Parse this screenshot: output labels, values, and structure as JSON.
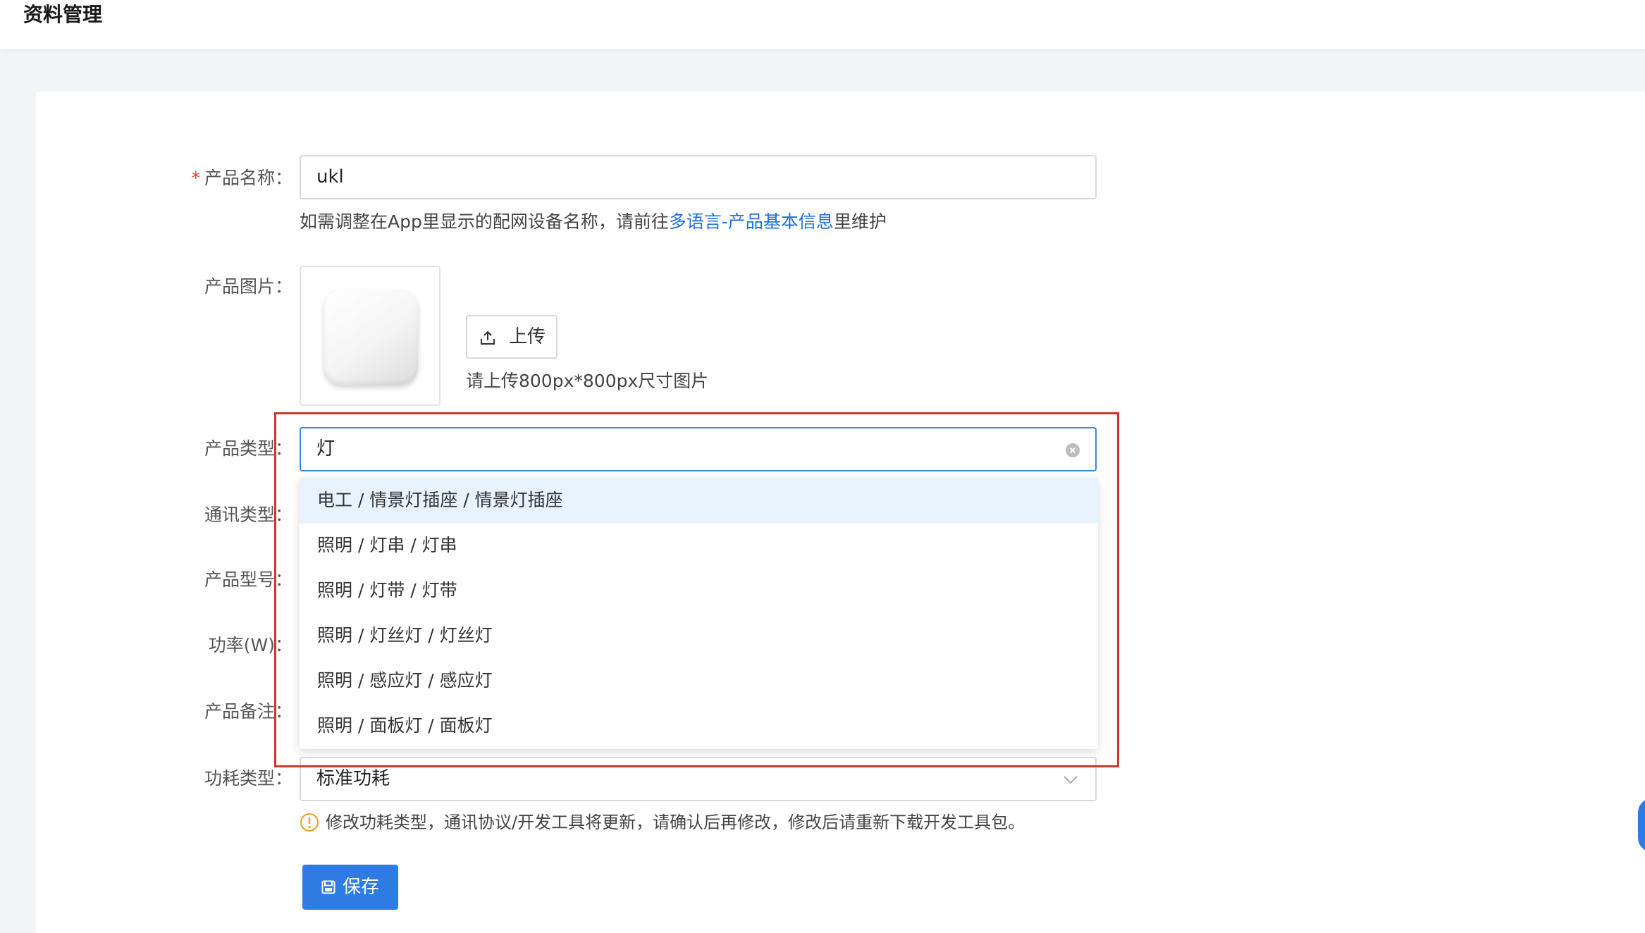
{
  "header": {
    "title": "资料管理"
  },
  "form": {
    "required_mark": "*",
    "product_name": {
      "label": "产品名称：",
      "value": "ukl"
    },
    "name_hint": {
      "prefix": "如需调整在App里显示的配网设备名称，请前往",
      "link": "多语言-产品基本信息",
      "suffix": "里维护"
    },
    "product_image": {
      "label": "产品图片：",
      "upload_label": "上传",
      "upload_hint": "请上传800px*800px尺寸图片"
    },
    "product_type": {
      "label": "产品类型：",
      "search_value": "灯",
      "options": [
        "电工 / 情景灯插座 / 情景灯插座",
        "照明 / 灯串 / 灯串",
        "照明 / 灯带 / 灯带",
        "照明 / 灯丝灯 / 灯丝灯",
        "照明 / 感应灯 / 感应灯",
        "照明 / 面板灯 / 面板灯"
      ]
    },
    "comm_type": {
      "label": "通讯类型："
    },
    "product_model": {
      "label": "产品型号："
    },
    "power": {
      "label": "功率(W)："
    },
    "remark": {
      "label": "产品备注："
    },
    "power_consumption": {
      "label": "功耗类型：",
      "value": "标准功耗",
      "warning": "修改功耗类型，通讯协议/开发工具将更新，请确认后再修改，修改后请重新下载开发工具包。"
    },
    "save_label": "保存"
  },
  "colors": {
    "primary": "#2d7be3",
    "link": "#1f6fe0",
    "highlight_border": "#d0342c",
    "warning": "#f0a020",
    "required": "#e83b3b"
  }
}
